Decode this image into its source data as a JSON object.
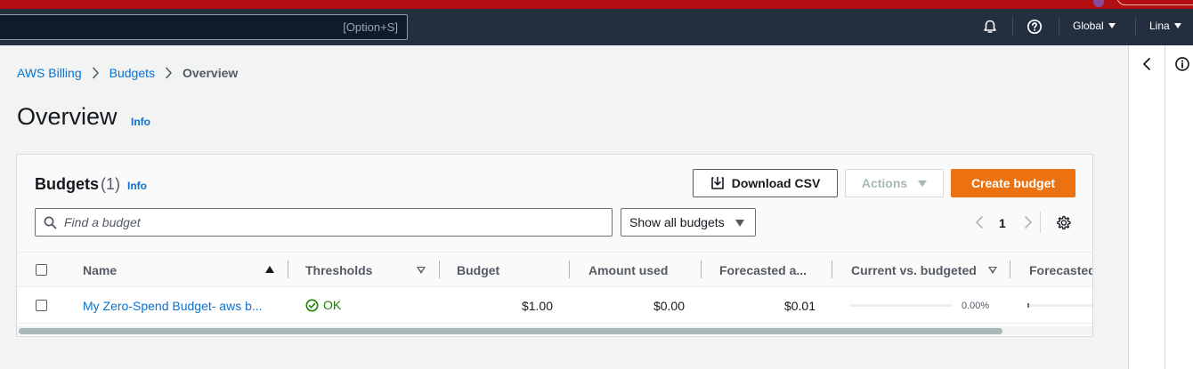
{
  "topbar": {
    "search_shortcut": "[Option+S]",
    "region": "Global",
    "user": "Lina"
  },
  "breadcrumb": [
    "AWS Billing",
    "Budgets",
    "Overview"
  ],
  "page": {
    "title": "Overview",
    "info": "Info"
  },
  "budgets": {
    "title": "Budgets",
    "count": "(1)",
    "info": "Info",
    "download_csv": "Download CSV",
    "actions": "Actions",
    "create_budget": "Create budget",
    "search_placeholder": "Find a budget",
    "filter_select": "Show all budgets",
    "page_number": "1",
    "columns": [
      "Name",
      "Thresholds",
      "Budget",
      "Amount used",
      "Forecasted a...",
      "Current vs. budgeted",
      "Forecasted"
    ],
    "rows": [
      {
        "name": "My Zero-Spend Budget- aws b...",
        "thresholds": "OK",
        "budget": "$1.00",
        "amount_used": "$0.00",
        "forecasted_amount": "$0.01",
        "current_vs_budgeted": "0.00%",
        "current_vs_budgeted_fraction": 0.0
      }
    ]
  },
  "colors": {
    "aws_orange": "#ec7211",
    "link_blue": "#0972d3",
    "ok_green": "#1d8102",
    "nav_dark": "#232f3e",
    "top_red": "#b20e11"
  }
}
